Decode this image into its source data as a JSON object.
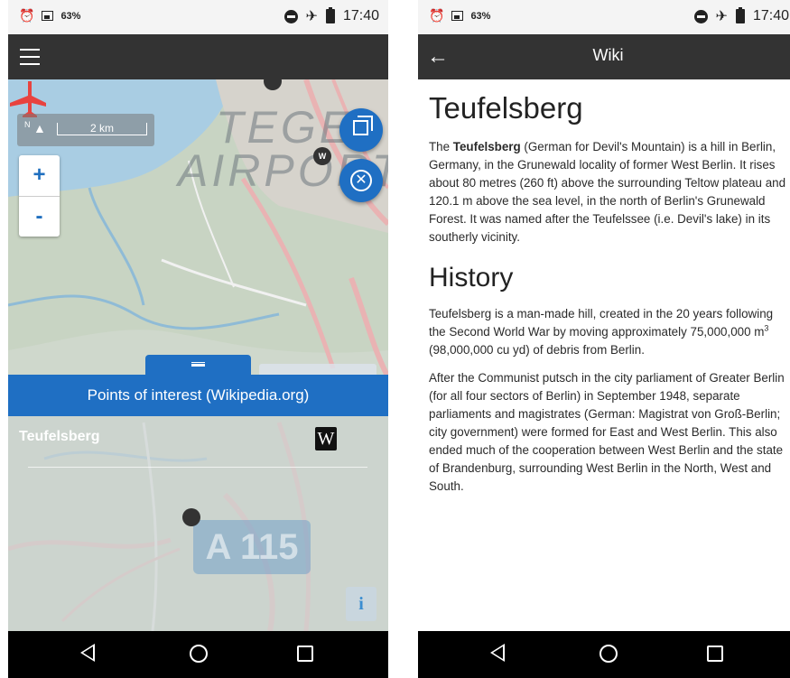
{
  "status_bar": {
    "battery": "63%",
    "time": "17:40"
  },
  "left_screen": {
    "scale": {
      "north": "N",
      "distance": "2 km"
    },
    "zoom": {
      "in": "+",
      "out": "-"
    },
    "map_labels": {
      "line1": "TEGEL",
      "line2": "AIRPORT",
      "road_sign": "A 115"
    },
    "marker_label": "W",
    "bottom_sheet": {
      "header": "Points of interest (Wikipedia.org)",
      "items": [
        {
          "title": "Teufelsberg",
          "source_badge": "W"
        }
      ],
      "info_button": "i"
    },
    "colors": {
      "accent": "#1f6fc3",
      "appbar": "#333333"
    }
  },
  "right_screen": {
    "appbar_title": "Wiki",
    "article": {
      "title": "Teufelsberg",
      "intro_lead": "The ",
      "intro_bold": "Teufelsberg",
      "intro_rest": " (German for Devil's Mountain) is a hill in Berlin, Germany, in the Grunewald locality of former West Berlin. It rises about 80 metres (260 ft) above the surrounding Teltow plateau and 120.1 m above the sea level, in the north of Berlin's Grunewald Forest. It was named after the Teufelssee (i.e. Devil's lake) in its southerly vicinity.",
      "section_title": "History",
      "history_p1_a": "Teufelsberg is a man-made hill, created in the 20 years following the Second World War by moving approximately 75,000,000 m",
      "history_p1_sup": "3",
      "history_p1_b": " (98,000,000 cu yd) of debris from Berlin.",
      "history_p2": "After the Communist putsch in the city parliament of Greater Berlin (for all four sectors of Berlin) in September 1948, separate parliaments and magistrates (German: Magistrat von Groß-Berlin; city government) were formed for East and West Berlin. This also ended much of the cooperation between West Berlin and the state of Brandenburg, surrounding West Berlin in the North, West and South."
    }
  },
  "icons": {
    "alarm": "alarm-icon",
    "image": "image-notification-icon",
    "dnd": "do-not-disturb-icon",
    "airplane": "airplane-mode-icon",
    "battery": "battery-icon",
    "menu": "hamburger-menu-icon",
    "back": "back-arrow-icon",
    "layers": "layers-icon",
    "close": "close-circle-icon",
    "nav_back": "nav-back-icon",
    "nav_home": "nav-home-icon",
    "nav_recent": "nav-recent-icon"
  }
}
